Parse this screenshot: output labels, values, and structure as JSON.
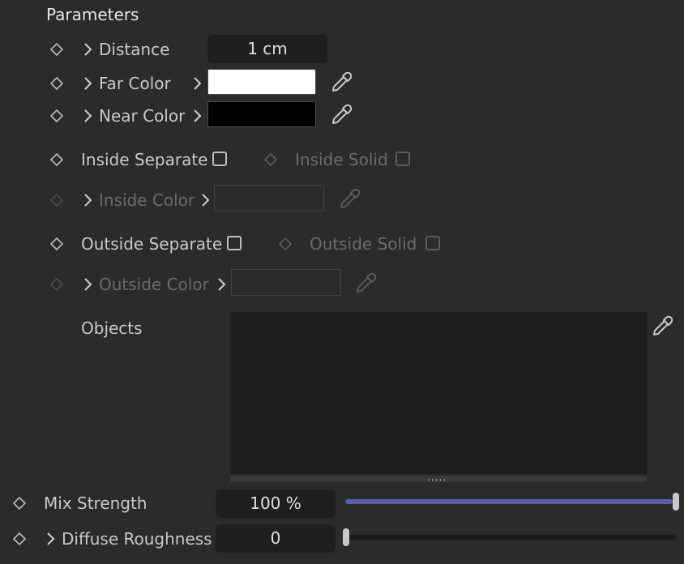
{
  "section": {
    "title": "Parameters"
  },
  "params": {
    "distance": {
      "label": "Distance",
      "value": "1 cm"
    },
    "far_color": {
      "label": "Far Color",
      "color": "#ffffff"
    },
    "near_color": {
      "label": "Near Color",
      "color": "#000000"
    },
    "inside_separate": {
      "label": "Inside Separate",
      "checked": false
    },
    "inside_solid": {
      "label": "Inside Solid",
      "checked": false
    },
    "inside_color": {
      "label": "Inside Color"
    },
    "outside_separate": {
      "label": "Outside Separate",
      "checked": false
    },
    "outside_solid": {
      "label": "Outside Solid",
      "checked": false
    },
    "outside_color": {
      "label": "Outside Color"
    },
    "objects": {
      "label": "Objects",
      "handle": "....."
    },
    "mix_strength": {
      "label": "Mix Strength",
      "value": "100 %",
      "fraction": 1.0
    },
    "diffuse_roughness": {
      "label": "Diffuse Roughness",
      "value": "0",
      "fraction": 0.0
    }
  },
  "icons": {
    "keyframe": "diamond-icon",
    "expand": "chevron-right-icon",
    "picker": "eyedropper-icon"
  },
  "colors": {
    "accent": "#5b5fa8",
    "background": "#2b2b2b",
    "field": "#1f1f1f"
  }
}
